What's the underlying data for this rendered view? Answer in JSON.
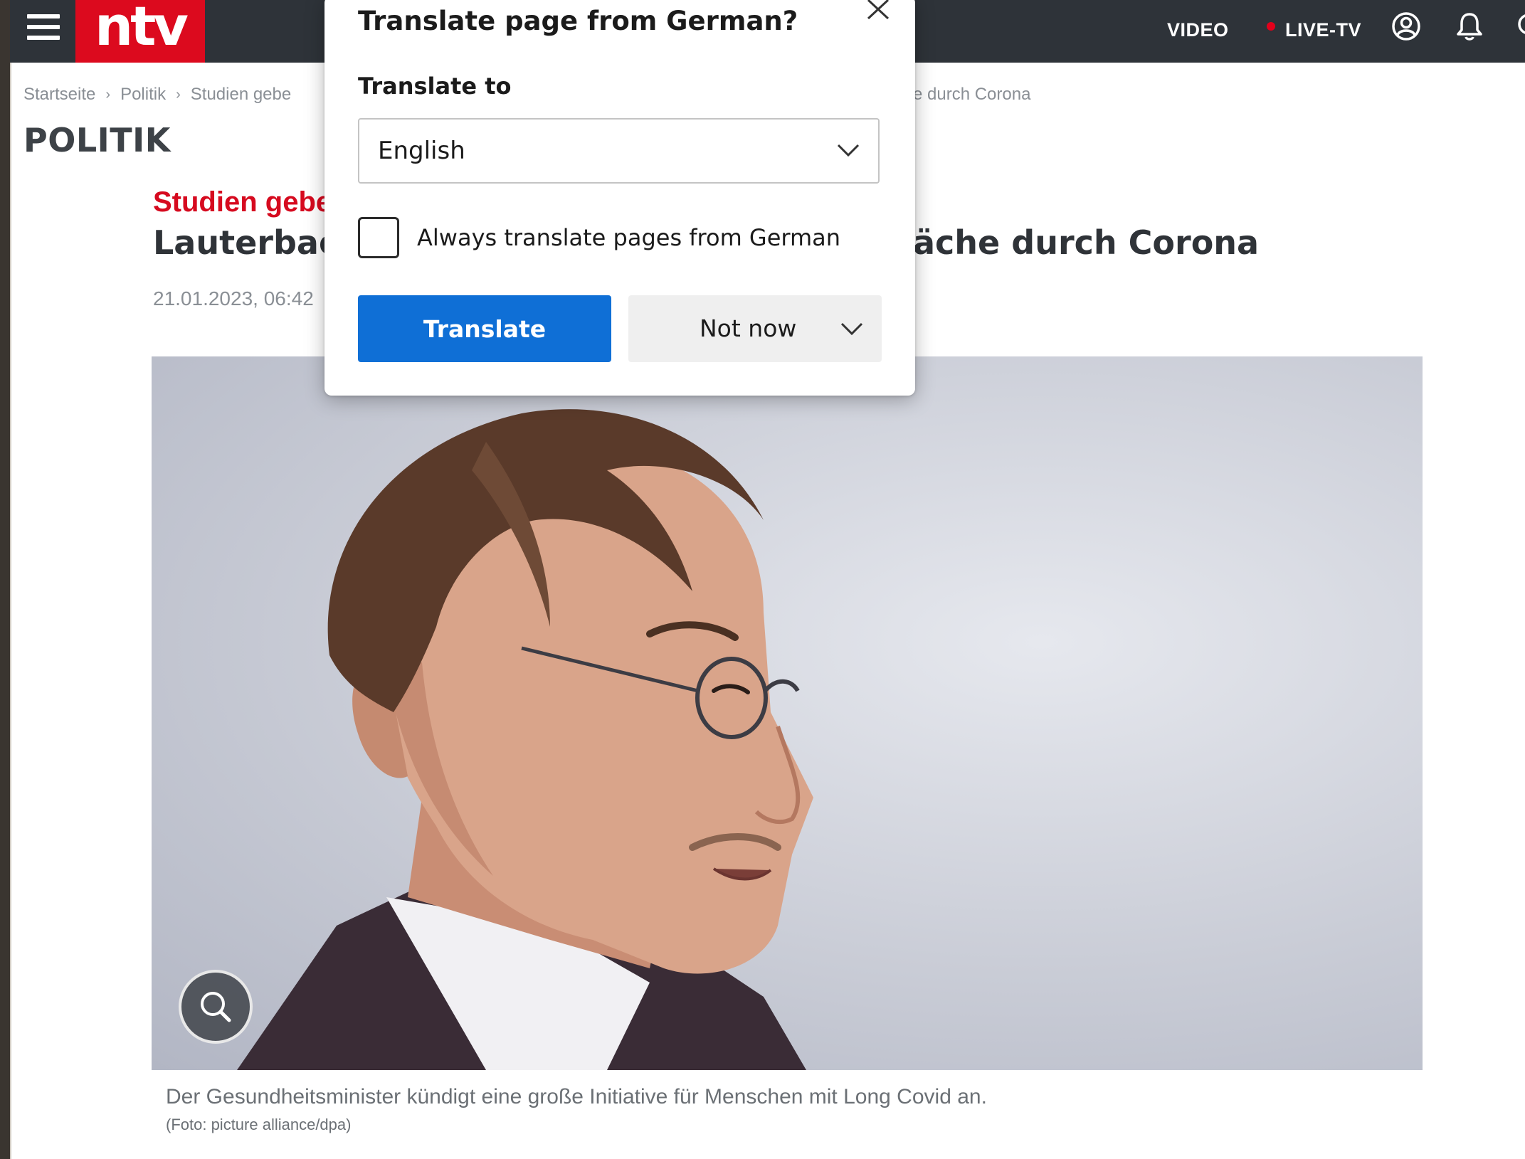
{
  "header": {
    "logo_text": "ntv",
    "nav_video": "VIDEO",
    "nav_live_tv": "LIVE-TV",
    "icons": [
      "menu-icon",
      "account-icon",
      "bell-icon"
    ],
    "brand_color": "#dc0a1e",
    "bar_color": "#2e3339"
  },
  "breadcrumb": {
    "items": [
      "Startseite",
      "Politik",
      "Studien gebe"
    ],
    "tail": "e durch Corona"
  },
  "section": {
    "title": "POLITIK"
  },
  "article": {
    "kicker": "Studien gebe",
    "headline_left": "Lauterbacl",
    "headline_right": "äche durch Corona",
    "dateline": "21.01.2023, 06:42",
    "caption": "Der Gesundheitsminister kündigt eine große Initiative für Menschen mit Long Covid an.",
    "credit": "(Foto: picture alliance/dpa)",
    "kicker_color": "#d60a1f"
  },
  "translate_popup": {
    "title": "Translate page from German?",
    "translate_to_label": "Translate to",
    "selected_language": "English",
    "always_translate_label": "Always translate pages from German",
    "always_translate_checked": false,
    "translate_button": "Translate",
    "not_now_button": "Not now",
    "primary_color": "#0f6fd6"
  }
}
